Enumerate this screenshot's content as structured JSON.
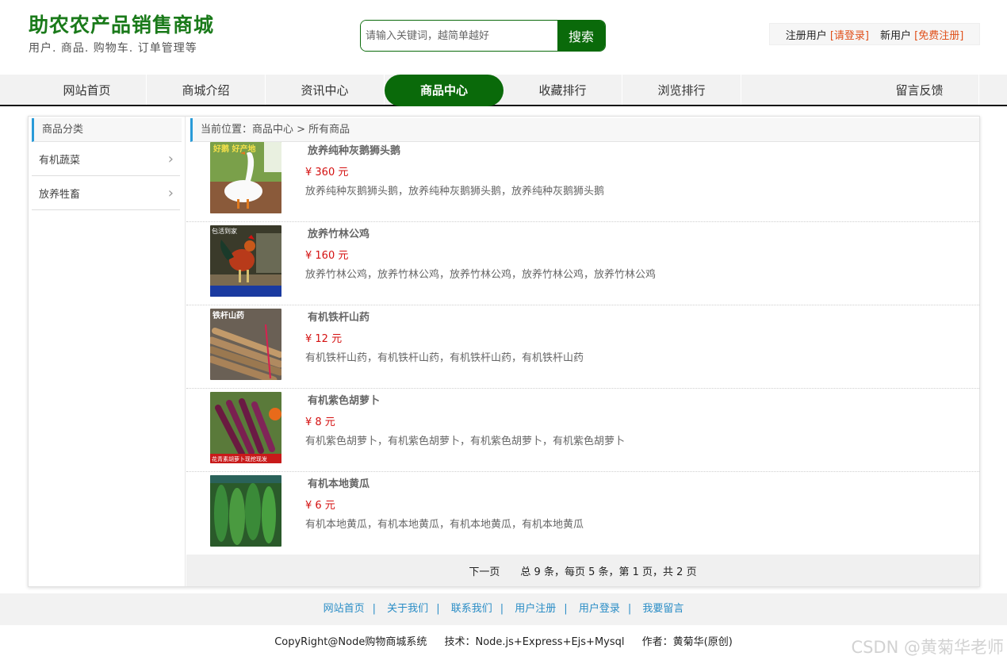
{
  "header": {
    "site_title": "助农农产品销售商城",
    "subtitle": "用户. 商品. 购物车. 订单管理等",
    "search_placeholder": "请输入关键词，越简单越好",
    "search_button": "搜索",
    "register_user_label": "注册用户",
    "login_link": "[请登录]",
    "new_user_label": "新用户",
    "signup_link": "[免费注册]"
  },
  "nav": {
    "items": [
      {
        "label": "网站首页"
      },
      {
        "label": "商城介绍"
      },
      {
        "label": "资讯中心"
      },
      {
        "label": "商品中心"
      },
      {
        "label": "收藏排行"
      },
      {
        "label": "浏览排行"
      },
      {
        "label": "留言反馈"
      }
    ],
    "active": "商品中心"
  },
  "sidebar": {
    "title": "商品分类",
    "categories": [
      {
        "label": "有机蔬菜"
      },
      {
        "label": "放养牲畜"
      }
    ]
  },
  "breadcrumb": "当前位置：商品中心 > 所有商品",
  "products": [
    {
      "name": "放养纯种灰鹅狮头鹅",
      "price": "¥ 360 元",
      "desc": "放养纯种灰鹅狮头鹅，放养纯种灰鹅狮头鹅，放养纯种灰鹅狮头鹅",
      "image_text": "好鹅 好产地"
    },
    {
      "name": "放养竹林公鸡",
      "price": "¥ 160 元",
      "desc": "放养竹林公鸡，放养竹林公鸡，放养竹林公鸡，放养竹林公鸡，放养竹林公鸡",
      "image_text": "包活到家"
    },
    {
      "name": "有机铁杆山药",
      "price": "¥ 12 元",
      "desc": "有机铁杆山药，有机铁杆山药，有机铁杆山药，有机铁杆山药",
      "image_text": "铁杆山药"
    },
    {
      "name": "有机紫色胡萝卜",
      "price": "¥ 8 元",
      "desc": "有机紫色胡萝卜，有机紫色胡萝卜，有机紫色胡萝卜，有机紫色胡萝卜",
      "image_text": "花青素胡萝卜现挖现发"
    },
    {
      "name": "有机本地黄瓜",
      "price": "¥ 6 元",
      "desc": "有机本地黄瓜，有机本地黄瓜，有机本地黄瓜，有机本地黄瓜",
      "image_text": ""
    }
  ],
  "pager": {
    "next": "下一页",
    "summary": "总 9 条，每页 5 条，第 1 页，共 2 页"
  },
  "footer": {
    "links": [
      {
        "label": "网站首页"
      },
      {
        "label": "关于我们"
      },
      {
        "label": "联系我们"
      },
      {
        "label": "用户注册"
      },
      {
        "label": "用户登录"
      },
      {
        "label": "我要留言"
      }
    ],
    "separator": "|",
    "copyright": "CopyRight@Node购物商城系统",
    "tech": "技术：Node.js+Express+Ejs+Mysql",
    "author": "作者：黄菊华(原创)"
  },
  "watermark": "CSDN @黄菊华老师",
  "colors": {
    "brand_green": "#0a6a0a",
    "price_red": "#d41010",
    "link_blue": "#2a8dc6",
    "accent_orange": "#e0501a"
  }
}
